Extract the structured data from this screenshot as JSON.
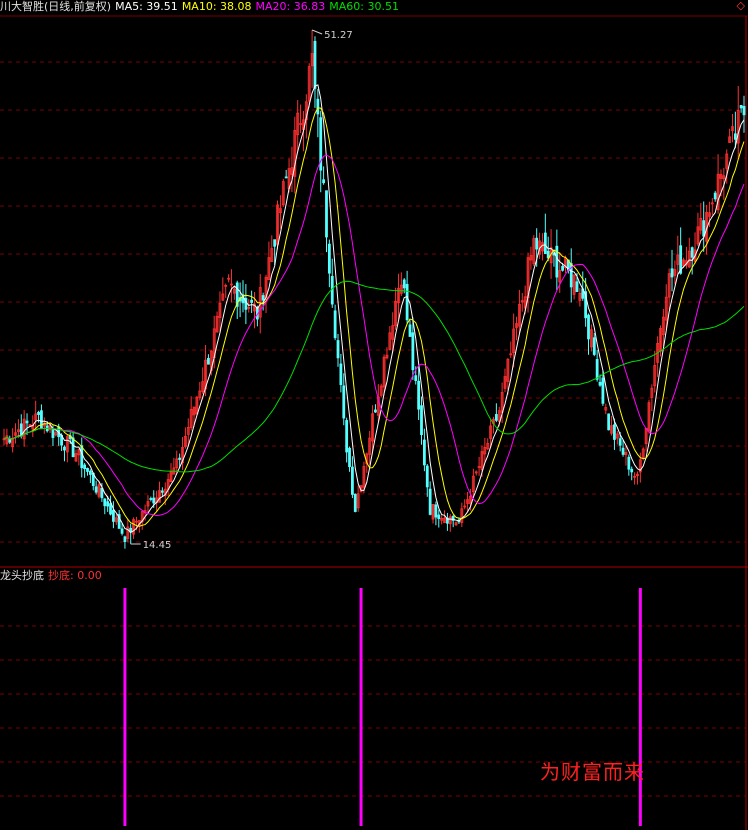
{
  "header": {
    "stock_title": "川大智胜(日线,前复权)",
    "ma5_label": "MA5: 39.51",
    "ma10_label": "MA10: 38.08",
    "ma20_label": "MA20: 36.83",
    "ma60_label": "MA60: 30.51",
    "corner_icon": "diamond-icon"
  },
  "indicator": {
    "name": "龙头抄底",
    "value_label": "抄底: 0.00"
  },
  "watermark": "为财富而来",
  "colors": {
    "background": "#000000",
    "grid": "#7a0000",
    "up_candle": "#ff3030",
    "down_candle": "#54ffff",
    "ma5": "#ffffff",
    "ma10": "#ffff00",
    "ma20": "#ff00ff",
    "ma60": "#00dd00",
    "signal": "#ff00ff"
  },
  "chart_data": {
    "type": "candlestick",
    "title": "川大智胜(日线,前复权)",
    "annotations": [
      {
        "label": "51.27",
        "kind": "high",
        "value": 51.27,
        "bar_index": 107
      },
      {
        "label": "14.45",
        "kind": "low",
        "value": 14.45,
        "bar_index": 44
      }
    ],
    "key_points": [
      [
        0,
        22
      ],
      [
        12,
        23.5
      ],
      [
        25,
        21
      ],
      [
        42,
        15
      ],
      [
        60,
        20
      ],
      [
        78,
        33
      ],
      [
        88,
        31
      ],
      [
        107,
        49
      ],
      [
        118,
        23
      ],
      [
        122,
        17
      ],
      [
        138,
        34
      ],
      [
        148,
        17
      ],
      [
        158,
        16
      ],
      [
        172,
        24
      ],
      [
        184,
        36
      ],
      [
        200,
        33
      ],
      [
        210,
        23
      ],
      [
        220,
        19
      ],
      [
        230,
        33
      ],
      [
        242,
        37
      ],
      [
        258,
        46
      ]
    ],
    "ma_lines": {
      "MA5": 39.51,
      "MA10": 38.08,
      "MA20": 36.83,
      "MA60": 30.51
    },
    "bars_count": 258,
    "y_range": [
      14.45,
      51.27
    ],
    "indicator": {
      "name": "龙头抄底",
      "value": 0.0,
      "signal_bars": [
        42,
        124,
        221
      ]
    }
  }
}
